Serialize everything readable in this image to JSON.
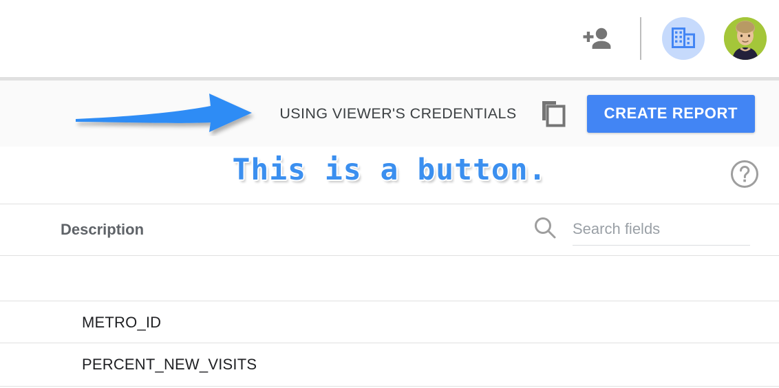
{
  "topbar": {
    "add_person_icon": "person-add-icon",
    "org_icon": "organization-building-icon",
    "avatar_label": "user-avatar"
  },
  "toolbar": {
    "credentials_label": "USING VIEWER'S CREDENTIALS",
    "copy_icon": "copy-icon",
    "create_report_label": "CREATE REPORT",
    "accent_color": "#4285f4"
  },
  "annotation": {
    "text": "This is a button.",
    "text_color": "#3b8fef",
    "arrow_color": "#2f8cf5",
    "arrow_name": "annotation-arrow-pointing-right"
  },
  "help": {
    "icon": "help-circle-icon"
  },
  "fields_panel": {
    "description_header": "Description",
    "search": {
      "icon": "search-icon",
      "value": "",
      "placeholder": "Search fields"
    },
    "rows": [
      {
        "name": ""
      },
      {
        "name": "METRO_ID"
      },
      {
        "name": "PERCENT_NEW_VISITS"
      }
    ]
  }
}
